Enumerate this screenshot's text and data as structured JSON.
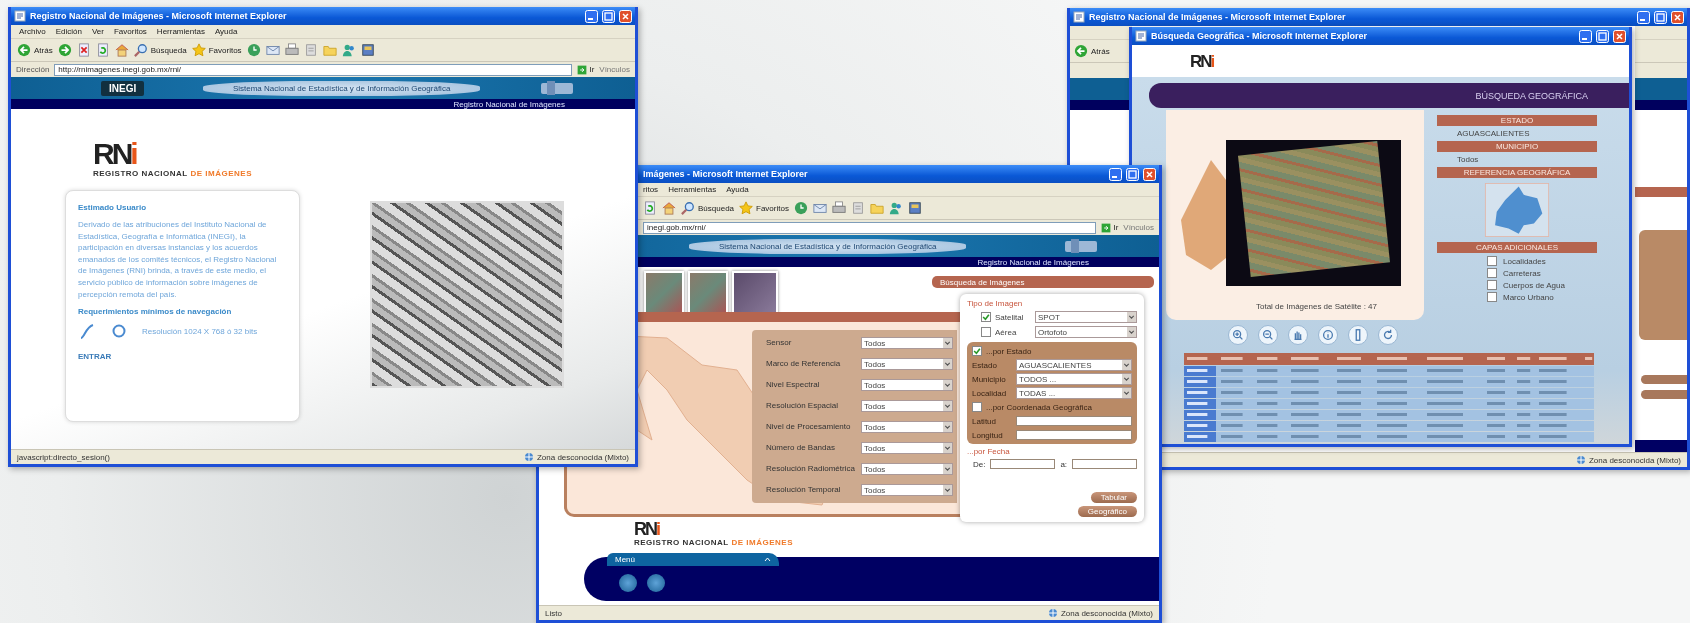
{
  "home_window": {
    "title": "Registro Nacional de Imágenes - Microsoft Internet Explorer",
    "menu": [
      "Archivo",
      "Edición",
      "Ver",
      "Favoritos",
      "Herramientas",
      "Ayuda"
    ],
    "toolbar": [
      {
        "kind": "back",
        "label": "Atrás"
      },
      {
        "kind": "forward"
      },
      {
        "kind": "stop"
      },
      {
        "kind": "refresh"
      },
      {
        "kind": "home"
      },
      {
        "kind": "search",
        "label": "Búsqueda"
      },
      {
        "kind": "favorites",
        "label": "Favoritos"
      },
      {
        "kind": "history"
      },
      {
        "kind": "mail"
      },
      {
        "kind": "print"
      },
      {
        "kind": "edit"
      },
      {
        "kind": "folder"
      },
      {
        "kind": "messenger"
      },
      {
        "kind": "research"
      }
    ],
    "address_label": "Dirección",
    "address": "http://rnimagenes.inegi.gob.mx/rni/",
    "go": "Ir",
    "links": "Vínculos",
    "banner": {
      "logo": "INEGI",
      "center": "Sistema Nacional de Estadística y de Información Geográfica",
      "caption": "Registro Nacional de Imágenes"
    },
    "logo": {
      "mark": "RN",
      "accent": "i",
      "tagline": "REGISTRO NACIONAL",
      "tagline_accent": "DE IMÁGENES"
    },
    "card": {
      "heading": "Estimado Usuario",
      "body": "Derivado de las atribuciones del Instituto Nacional de Estadística, Geografía e Informática (INEGI), la participación en diversas instancias y los acuerdos emanados de los comités técnicos, el Registro Nacional de Imágenes (RNI) brinda, a través de este medio, el servicio público de información sobre imágenes de percepción remota del país.",
      "requirements_heading": "Requerimientos mínimos de navegación",
      "resolution": "Resolución 1024 X 768 ó 32 bits",
      "enter": "ENTRAR"
    },
    "status": "javascript:directo_sesion()",
    "zone": "Zona desconocida (Mixto)"
  },
  "search_window": {
    "title": "Imágenes - Microsoft Internet Explorer",
    "menu": [
      "ritos",
      "Herramientas",
      "Ayuda"
    ],
    "toolbar": [
      {
        "kind": "refresh"
      },
      {
        "kind": "home"
      },
      {
        "kind": "search",
        "label": "Búsqueda"
      },
      {
        "kind": "favorites",
        "label": "Favoritos"
      },
      {
        "kind": "history"
      },
      {
        "kind": "mail"
      },
      {
        "kind": "print"
      },
      {
        "kind": "edit"
      },
      {
        "kind": "folder"
      },
      {
        "kind": "messenger"
      },
      {
        "kind": "research"
      }
    ],
    "address": "inegi.gob.mx/rni/",
    "go": "Ir",
    "links": "Vínculos",
    "banner": {
      "center": "Sistema Nacional de Estadística y de Información Geográfica",
      "caption": "Registro Nacional de Imágenes"
    },
    "panel_title": "Búsqueda de Imágenes",
    "filters": [
      {
        "label": "Sensor",
        "value": "Todos"
      },
      {
        "label": "Marco de Referencia",
        "value": "Todos"
      },
      {
        "label": "Nivel Espectral",
        "value": "Todos"
      },
      {
        "label": "Resolución Espacial",
        "value": "Todos"
      },
      {
        "label": "Nivel de Procesamiento",
        "value": "Todos"
      },
      {
        "label": "Número de Bandas",
        "value": "Todos"
      },
      {
        "label": "Resolución Radiométrica",
        "value": "Todos"
      },
      {
        "label": "Resolución Temporal",
        "value": "Todos"
      }
    ],
    "image_type": {
      "heading": "Tipo de Imagen",
      "options": [
        {
          "label": "Satelital",
          "checked": true,
          "value": "SPOT"
        },
        {
          "label": "Aérea",
          "checked": false,
          "value": "Ortofoto"
        }
      ]
    },
    "by_state": {
      "label": "...por Estado",
      "checked": true,
      "fields": [
        {
          "label": "Estado",
          "value": "AGUASCALIENTES"
        },
        {
          "label": "Municipio",
          "value": "TODOS ..."
        },
        {
          "label": "Localidad",
          "value": "TODAS ..."
        }
      ]
    },
    "by_coordinate": {
      "label": "...por Coordenada Geográfica",
      "checked": false,
      "fields": [
        "Latitud",
        "Longitud"
      ]
    },
    "by_date": {
      "label": "...por Fecha",
      "from": "De:",
      "to": "a:"
    },
    "buttons": [
      "Tabular",
      "Geográfico"
    ],
    "logo": {
      "mark": "RN",
      "accent": "i",
      "tagline": "REGISTRO NACIONAL",
      "tagline_accent": "DE IMÁGENES"
    },
    "menu_tab": "Menú",
    "status": "Listo",
    "zone": "Zona desconocida (Mixto)"
  },
  "back_window": {
    "title": "Registro Nacional de Imágenes - Microsoft Internet Explorer",
    "back": "Atrás",
    "zone": "Zona desconocida (Mixto)"
  },
  "geo_popup": {
    "title": "Búsqueda Geográfica - Microsoft Internet Explorer",
    "logo": {
      "mark": "RN",
      "accent": "i"
    },
    "heading": "BÚSQUEDA GEOGRÁFICA",
    "caption": "Total de Imágenes de Satélite : 47",
    "state_heading": "ESTADO",
    "state": "AGUASCALIENTES",
    "municipality_heading": "MUNICIPIO",
    "municipality": "Todos",
    "reference_heading": "REFERENCIA GEOGRÁFICA",
    "layers_heading": "CAPAS ADICIONALES",
    "layers": [
      {
        "label": "Localidades",
        "checked": false
      },
      {
        "label": "Carreteras",
        "checked": false
      },
      {
        "label": "Cuerpos de Agua",
        "checked": false
      },
      {
        "label": "Marco Urbano",
        "checked": false
      }
    ]
  }
}
